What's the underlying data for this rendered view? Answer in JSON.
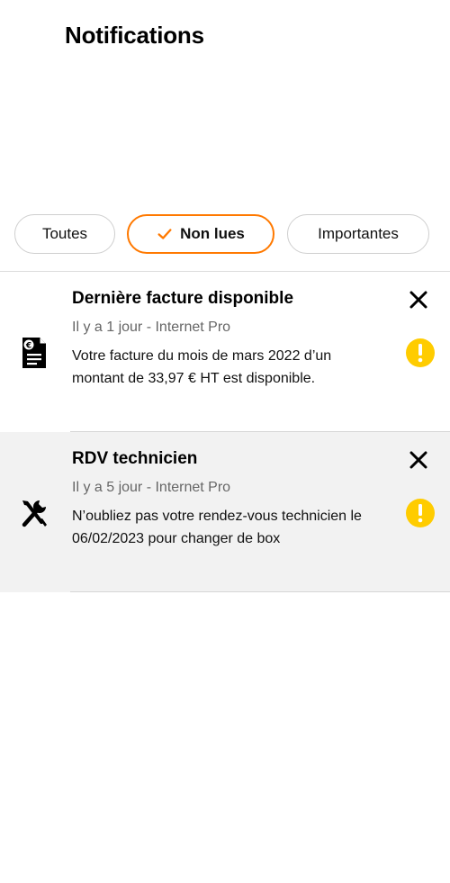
{
  "page": {
    "title": "Notifications"
  },
  "filters": {
    "all_label": "Toutes",
    "unread_label": "Non lues",
    "important_label": "Importantes",
    "selected": "Non lues"
  },
  "notifications": [
    {
      "title": "Dernière facture disponible",
      "meta": "Il y a 1 jour - Internet Pro",
      "body": "Votre facture du mois de mars 2022 d’un montant de 33,97 € HT est disponible.",
      "icon": "invoice-icon",
      "important": true
    },
    {
      "title": "RDV technicien",
      "meta": "Il y a 5 jour - Internet Pro",
      "body": "N’oubliez pas votre rendez-vous technicien le 06/02/2023 pour changer de box",
      "icon": "tools-icon",
      "important": true
    }
  ],
  "colors": {
    "accent": "#ff7900",
    "alert": "#ffcc00",
    "selected_row_bg": "#f2f2f2",
    "meta_text": "#666666"
  }
}
